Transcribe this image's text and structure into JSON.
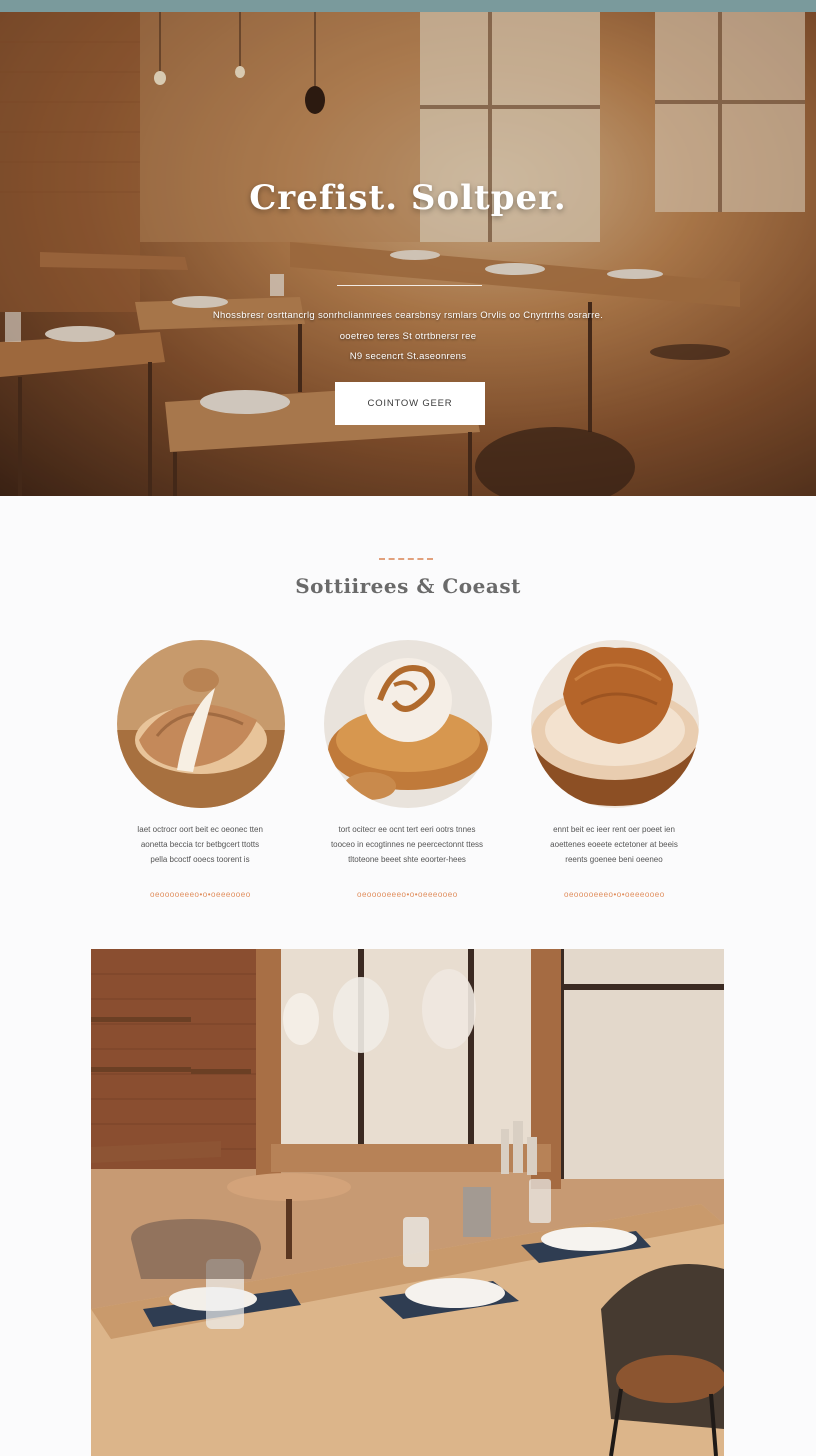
{
  "hero": {
    "title": "Crefist. Soltper.",
    "lines": [
      "Nhossbresr osrttancrlg sonrhclianmrees cearsbnsy rsmlars Orvlis oo Cnyrtrrhs osrarre.",
      "ooetreo teres St otrtbnersr ree",
      "N9 secencrt St.aseonrens"
    ],
    "button_label": "COINTOW GEER"
  },
  "section": {
    "title": "Sottiirees & Coeast",
    "items": [
      {
        "desc": [
          "Iaet octrocr oort beit ec oeonec tten",
          "aonetta beccia tcr betbgcert ttotts",
          "pella bcoctf ooecs toorent is"
        ],
        "link": "oeooooeeeo•o•oeeeooeo"
      },
      {
        "desc": [
          "tort ocitecr ee ocnt tert eeri ootrs tnnes",
          "tooceo in ecogtinnes ne peercectonnt ttess",
          "tltoteone beeet shte eoorter-hees"
        ],
        "link": "oeooooeeeo•o•oeeeooeo"
      },
      {
        "desc": [
          "ennt beit ec ieer rent oer poeet ien",
          "aoettenes eoeete ectetoner at beeis",
          "reents goenee beni oeeneo"
        ],
        "link": "oeooooeeeo•o•oeeeooeo"
      }
    ]
  },
  "colors": {
    "top_bar": "#7a9a9c",
    "accent": "#e08e5d",
    "title_gray": "#6a6a6a"
  }
}
